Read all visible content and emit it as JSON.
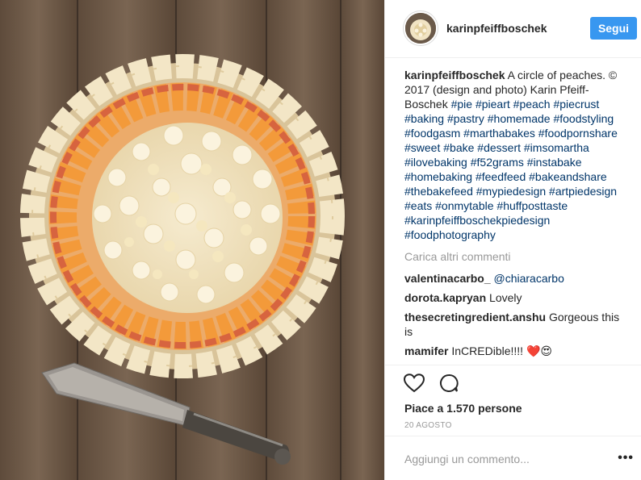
{
  "post": {
    "username": "karinpfeiffboschek",
    "follow_label": "Segui",
    "caption": {
      "user": "karinpfeiffboschek",
      "text": " A circle of peaches. © 2017 (design and photo) Karin Pfeiff-Boschek ",
      "hashtags": [
        "#pie",
        "#pieart",
        "#peach",
        "#piecrust",
        "#baking",
        "#pastry",
        "#homemade",
        "#foodstyling",
        "#foodgasm",
        "#marthabakes",
        "#foodpornshare",
        "#sweet",
        "#bake",
        "#dessert",
        "#imsomartha",
        "#ilovebaking",
        "#f52grams",
        "#instabake",
        "#homebaking",
        "#feedfeed",
        "#bakeandshare",
        "#thebakefeed",
        "#mypiedesign",
        "#artpiedesign",
        "#eats",
        "#onmytable",
        "#huffposttaste",
        "#karinpfeiffboschekpiedesign",
        "#foodphotography"
      ]
    },
    "load_more_label": "Carica altri commenti",
    "comments": [
      {
        "user": "valentinacarbo_",
        "text": "",
        "mention": "@chiaracarbo"
      },
      {
        "user": "dorota.kapryan",
        "text": "Lovely",
        "mention": ""
      },
      {
        "user": "thesecretingredient.anshu",
        "text": "Gorgeous this is",
        "mention": ""
      },
      {
        "user": "mamifer",
        "text": "InCREDible!!!! ❤️😍",
        "mention": ""
      }
    ],
    "likes_label": "Piace a 1.570 persone",
    "date_label": "20 AGOSTO",
    "add_comment_placeholder": "Aggiungi un commento...",
    "more_options_label": "•••"
  },
  "icons": {
    "like": "heart-icon",
    "comment": "comment-bubble-icon",
    "more": "more-options-icon"
  },
  "colors": {
    "follow_button": "#3897f0",
    "hashtag": "#003569",
    "muted": "#999999",
    "text": "#262626"
  }
}
